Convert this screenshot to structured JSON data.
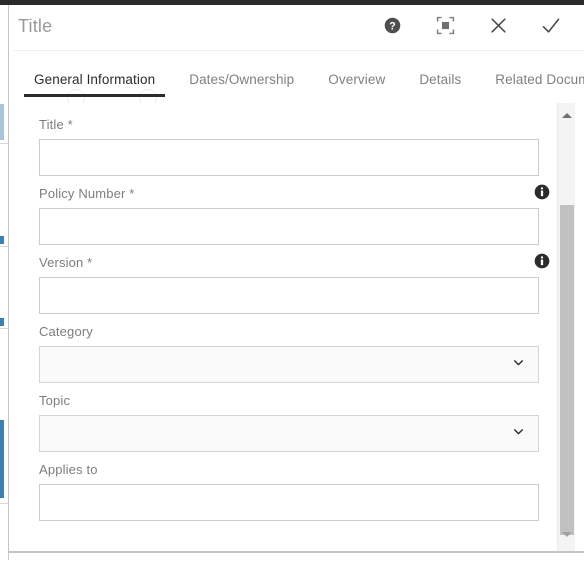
{
  "window": {
    "top_strip_color": "#2b2b2b",
    "background_accent_color": "#3c7fb1"
  },
  "dialog": {
    "title": "Title",
    "actions": [
      {
        "name": "help-icon",
        "label": "Help"
      },
      {
        "name": "maximize-icon",
        "label": "Maximize"
      },
      {
        "name": "close-icon",
        "label": "Close"
      },
      {
        "name": "confirm-icon",
        "label": "Save"
      }
    ]
  },
  "tabs": [
    {
      "label": "General Information",
      "active": true
    },
    {
      "label": "Dates/Ownership",
      "active": false
    },
    {
      "label": "Overview",
      "active": false
    },
    {
      "label": "Details",
      "active": false
    },
    {
      "label": "Related Documents",
      "active": false
    }
  ],
  "form": {
    "fields": [
      {
        "label": "Title *",
        "type": "text",
        "value": "",
        "placeholder": "",
        "info": false
      },
      {
        "label": "Policy Number *",
        "type": "text",
        "value": "",
        "placeholder": "",
        "info": true
      },
      {
        "label": "Version *",
        "type": "text",
        "value": "",
        "placeholder": "",
        "info": true
      },
      {
        "label": "Category",
        "type": "select",
        "value": "",
        "placeholder": "",
        "info": false
      },
      {
        "label": "Topic",
        "type": "select",
        "value": "",
        "placeholder": "",
        "info": false
      },
      {
        "label": "Applies to",
        "type": "text",
        "value": "",
        "placeholder": "",
        "info": false
      }
    ]
  },
  "scrollbar": {
    "up_arrow": "▲",
    "down_arrow": "▼",
    "thumb_top_pct": 23,
    "thumb_height_pct": 73
  }
}
